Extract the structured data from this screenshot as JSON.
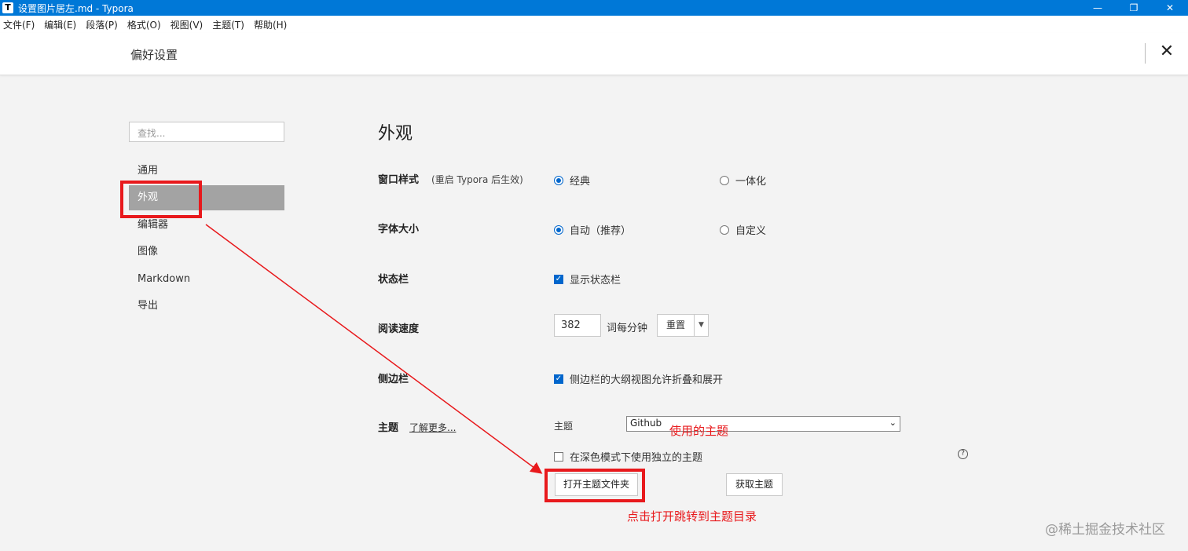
{
  "window": {
    "title": "设置图片居左.md - Typora",
    "app_icon": "T",
    "controls": [
      "—",
      "❐",
      "✕"
    ]
  },
  "menu": [
    "文件(F)",
    "编辑(E)",
    "段落(P)",
    "格式(O)",
    "视图(V)",
    "主题(T)",
    "帮助(H)"
  ],
  "prefs": {
    "title": "偏好设置",
    "close": "✕"
  },
  "sidebar": {
    "search_placeholder": "查找...",
    "items": [
      {
        "label": "通用",
        "active": false
      },
      {
        "label": "外观",
        "active": true
      },
      {
        "label": "编辑器",
        "active": false
      },
      {
        "label": "图像",
        "active": false
      },
      {
        "label": "Markdown",
        "active": false
      },
      {
        "label": "导出",
        "active": false
      }
    ]
  },
  "content": {
    "section_title": "外观",
    "window_style": {
      "label": "窗口样式",
      "note": "(重启 Typora 后生效)",
      "options": [
        {
          "label": "经典",
          "selected": true
        },
        {
          "label": "一体化",
          "selected": false
        }
      ]
    },
    "font_size": {
      "label": "字体大小",
      "options": [
        {
          "label": "自动（推荐）",
          "selected": true
        },
        {
          "label": "自定义",
          "selected": false
        }
      ]
    },
    "status_bar": {
      "label": "状态栏",
      "checkbox": {
        "label": "显示状态栏",
        "checked": true
      }
    },
    "reading_speed": {
      "label": "阅读速度",
      "value": "382",
      "unit": "词每分钟",
      "reset": "重置",
      "dropdown": "▼"
    },
    "sidebar_opt": {
      "label": "侧边栏",
      "checkbox": {
        "label": "侧边栏的大纲视图允许折叠和展开",
        "checked": true
      }
    },
    "theme": {
      "label": "主题",
      "learn_more": "了解更多...",
      "select_label": "主题",
      "selected": "Github",
      "dark_mode": {
        "label": "在深色模式下使用独立的主题",
        "checked": false
      },
      "help": "?",
      "open_folder": "打开主题文件夹",
      "get_themes": "获取主题"
    }
  },
  "annotations": {
    "theme_used": "使用的主题",
    "click_open": "点击打开跳转到主题目录",
    "color": "#e8191c"
  },
  "watermark": "@稀土掘金技术社区"
}
